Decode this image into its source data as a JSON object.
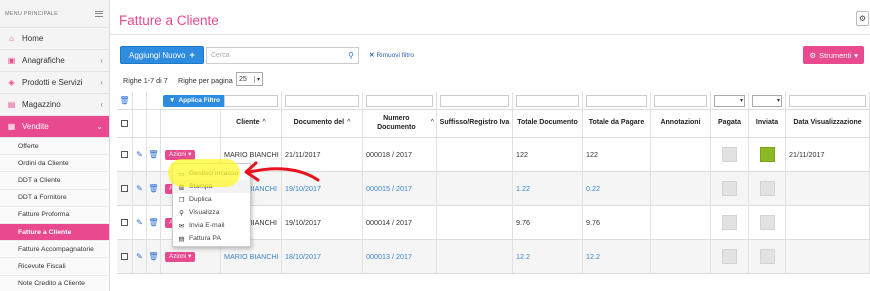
{
  "sidebar": {
    "header": "MENU PRINCIPALE",
    "items": [
      {
        "label": "Home",
        "icon": "home-icon",
        "glyph": "⌂",
        "has_chevron": false
      },
      {
        "label": "Anagrafiche",
        "icon": "users-icon",
        "glyph": "▣",
        "has_chevron": true
      },
      {
        "label": "Prodotti e Servizi",
        "icon": "tag-icon",
        "glyph": "◈",
        "has_chevron": true
      },
      {
        "label": "Magazzino",
        "icon": "warehouse-icon",
        "glyph": "▤",
        "has_chevron": true
      },
      {
        "label": "Vendite",
        "icon": "cart-icon",
        "glyph": "▦",
        "has_chevron": true,
        "active": true
      }
    ],
    "subitems": [
      {
        "label": "Offerte"
      },
      {
        "label": "Ordini da Cliente"
      },
      {
        "label": "DDT a Cliente"
      },
      {
        "label": "DDT a Fornitore"
      },
      {
        "label": "Fatture Proforma"
      },
      {
        "label": "Fatture a Cliente",
        "active": true
      },
      {
        "label": "Fatture Accompagnatorie"
      },
      {
        "label": "Ricevute Fiscali"
      },
      {
        "label": "Note Credito a Cliente"
      }
    ]
  },
  "page": {
    "title": "Fatture a Cliente"
  },
  "toolbar": {
    "add_label": "Aggiungi Nuovo",
    "search_placeholder": "Cerca",
    "remove_filter_label": "Rimuovi filtro",
    "tools_label": "Strumenti"
  },
  "pagination": {
    "rows_info": "Righe 1-7 di 7",
    "per_page_label": "Righe per pagina",
    "per_page_value": "25"
  },
  "filter_row": {
    "apply_label": "Applica Filtro"
  },
  "table": {
    "columns": [
      "Cliente",
      "Documento del",
      "Numero Documento",
      "Suffisso/Registro Iva",
      "Totale Documento",
      "Totale da Pagare",
      "Annotazioni",
      "Pagata",
      "Inviata",
      "Data Visualizzazione"
    ],
    "sort_marker": "^",
    "azioni_label": "Azioni",
    "rows": [
      {
        "cliente": "MARIO BIANCHI",
        "data": "21/11/2017",
        "numero": "000018 / 2017",
        "totale": "122",
        "da_pagare": "122",
        "inviata": true,
        "data_vis": "21/11/2017",
        "link": false
      },
      {
        "cliente": "BIANCHI",
        "data": "19/10/2017",
        "numero": "000015 / 2017",
        "totale": "1.22",
        "da_pagare": "0.22",
        "inviata": false,
        "data_vis": "",
        "link": true
      },
      {
        "cliente": "BIANCHI",
        "data": "19/10/2017",
        "numero": "000014 / 2017",
        "totale": "9.76",
        "da_pagare": "9.76",
        "inviata": false,
        "data_vis": "",
        "link": false
      },
      {
        "cliente": "MARIO BIANCHI",
        "data": "18/10/2017",
        "numero": "000013 / 2017",
        "totale": "12.2",
        "da_pagare": "12.2",
        "inviata": false,
        "data_vis": "",
        "link": true
      }
    ]
  },
  "actions_menu": {
    "items": [
      {
        "label": "Gestisci incasso",
        "icon": "money-icon",
        "glyph": "▭"
      },
      {
        "label": "Stampa",
        "icon": "print-icon",
        "glyph": "▥"
      },
      {
        "label": "Duplica",
        "icon": "copy-icon",
        "glyph": "❐"
      },
      {
        "label": "Visualizza",
        "icon": "search-icon",
        "glyph": "⚲"
      },
      {
        "label": "Invia E-mail",
        "icon": "envelope-icon",
        "glyph": "✉"
      },
      {
        "label": "Fattura PA",
        "icon": "document-icon",
        "glyph": "▤"
      }
    ]
  },
  "colors": {
    "accent": "#e8498f",
    "primary": "#2d8be0",
    "highlight": "#fff51e",
    "arrow": "#e8131f",
    "sent_green": "#8bb923"
  }
}
